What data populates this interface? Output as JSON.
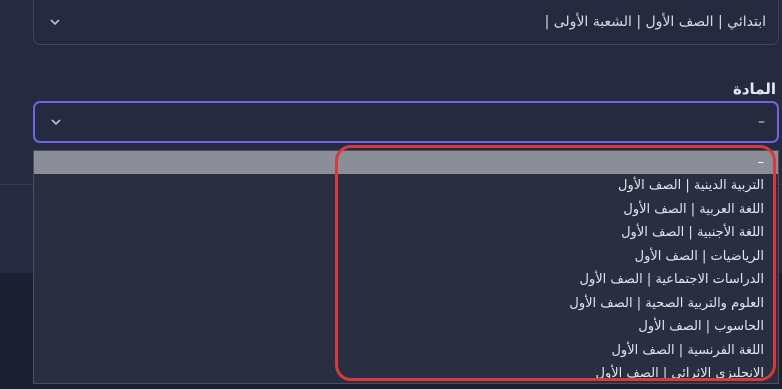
{
  "grade_section": {
    "value": "ابتدائي | الصف الأول | الشعبة الأولى |"
  },
  "subject": {
    "label": "المادة",
    "value": "–"
  },
  "dropdown": {
    "options": [
      "–",
      "التربية الدينية | الصف الأول",
      "اللغة العربية | الصف الأول",
      "اللغة الأجنبية | الصف الأول",
      "الرياضيات | الصف الأول",
      "الدراسات الاجتماعية | الصف الأول",
      "العلوم والتربية الصحية | الصف الأول",
      "الحاسوب | الصف الأول",
      "اللغة الفرنسية | الصف الأول",
      "الانجليزي الاثرائي | الصف الأول"
    ]
  },
  "icons": {
    "chevron": "chevron-down-icon"
  },
  "colors": {
    "focus_border": "#6a66e8",
    "selected_option_bg": "#8b8e97",
    "annotation_frame": "#d63a3a"
  }
}
